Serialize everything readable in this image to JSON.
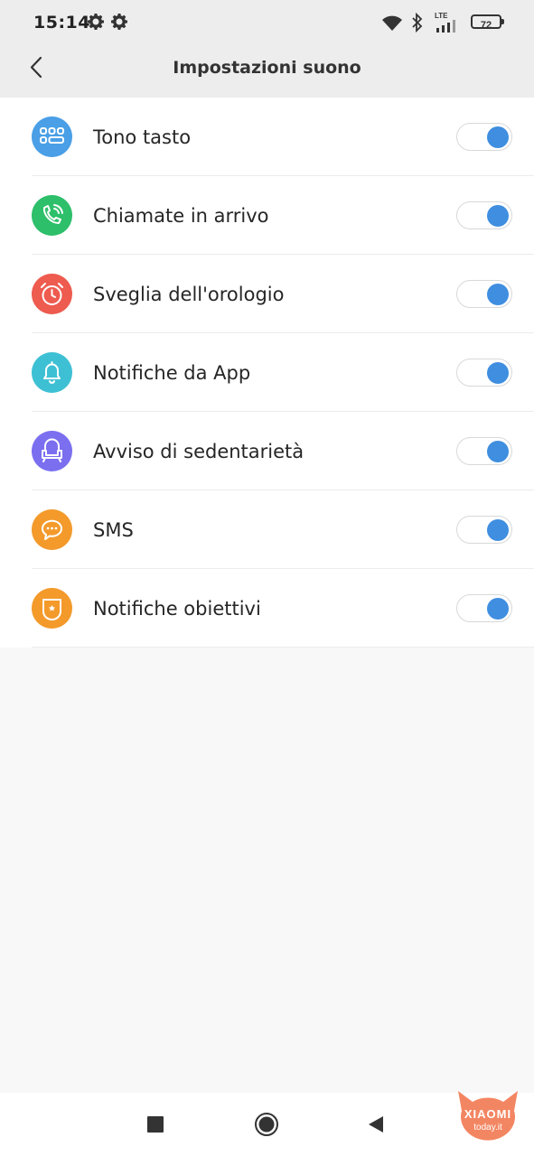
{
  "status": {
    "time": "15:14",
    "network": "LTE",
    "battery": "72"
  },
  "header": {
    "title": "Impostazioni suono",
    "back_icon": "chevron-left-icon"
  },
  "settings": [
    {
      "label": "Tono tasto",
      "icon": "keypad-icon",
      "color": "#4a9fe6",
      "enabled": true
    },
    {
      "label": "Chiamate in arrivo",
      "icon": "phone-call-icon",
      "color": "#2dbf6a",
      "enabled": true
    },
    {
      "label": "Sveglia dell'orologio",
      "icon": "alarm-clock-icon",
      "color": "#ee5b4f",
      "enabled": true
    },
    {
      "label": "Notifiche da App",
      "icon": "bell-icon",
      "color": "#3ec0d4",
      "enabled": true
    },
    {
      "label": "Avviso di sedentarietà",
      "icon": "armchair-icon",
      "color": "#7b6ff0",
      "enabled": true
    },
    {
      "label": "SMS",
      "icon": "chat-bubble-icon",
      "color": "#f39a2b",
      "enabled": true
    },
    {
      "label": "Notifiche obiettivi",
      "icon": "goal-badge-icon",
      "color": "#f39a2b",
      "enabled": true
    }
  ],
  "toggle_color": "#3f8ee0",
  "navbar": {
    "recents_icon": "square-icon",
    "home_icon": "circle-icon",
    "back_icon": "triangle-back-icon"
  },
  "watermark": {
    "brand": "XIAOMI",
    "site": "today.it",
    "color": "#f27f5a"
  }
}
